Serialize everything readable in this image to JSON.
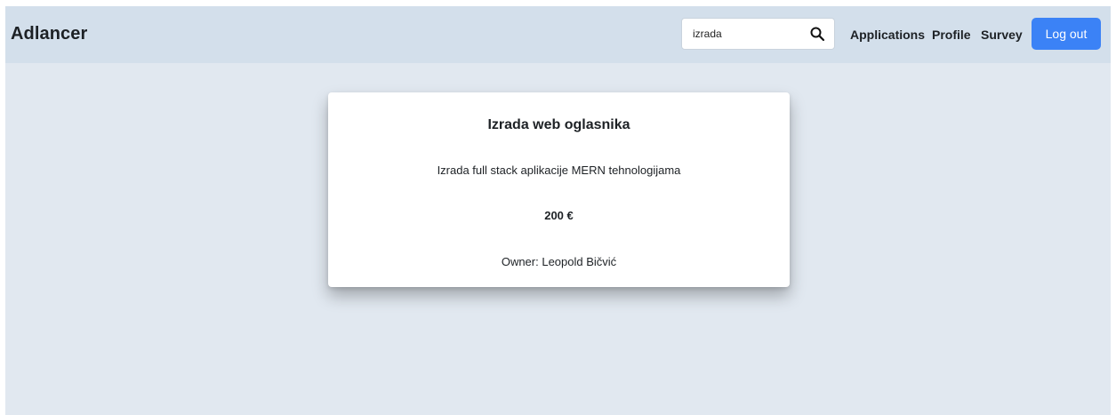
{
  "header": {
    "brand": "Adlancer",
    "search": {
      "value": "izrada",
      "icon": "search-icon"
    },
    "nav": {
      "applications": "Applications",
      "profile": "Profile",
      "survey": "Survey"
    },
    "logout_label": "Log out"
  },
  "listing": {
    "title": "Izrada web oglasnika",
    "description": "Izrada full stack aplikacije MERN tehnologijama",
    "price": "200 €",
    "owner": "Owner: Leopold Bičvić"
  },
  "colors": {
    "header_bg": "#d3dfeb",
    "page_bg": "#e1e8f0",
    "accent": "#3b82f6"
  }
}
